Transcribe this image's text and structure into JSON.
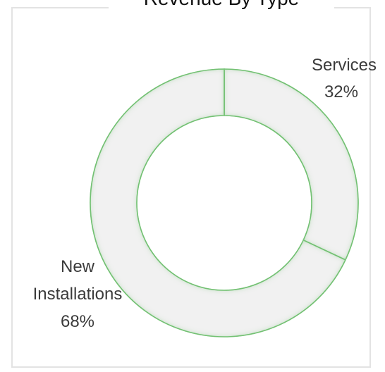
{
  "chart_data": {
    "type": "pie",
    "donut": true,
    "title": "Revenue By Type",
    "categories": [
      "Services",
      "New Installations"
    ],
    "values": [
      32,
      68
    ],
    "labels": [
      {
        "name": "Services",
        "percent": "32%"
      },
      {
        "name": "New Installations",
        "percent": "68%"
      }
    ],
    "colors": {
      "slice_fill": "#f1f1f1",
      "slice_stroke": "#5fb85f",
      "glow": "#9fd59f",
      "frame": "#e3e3e3"
    },
    "legend": "none"
  }
}
